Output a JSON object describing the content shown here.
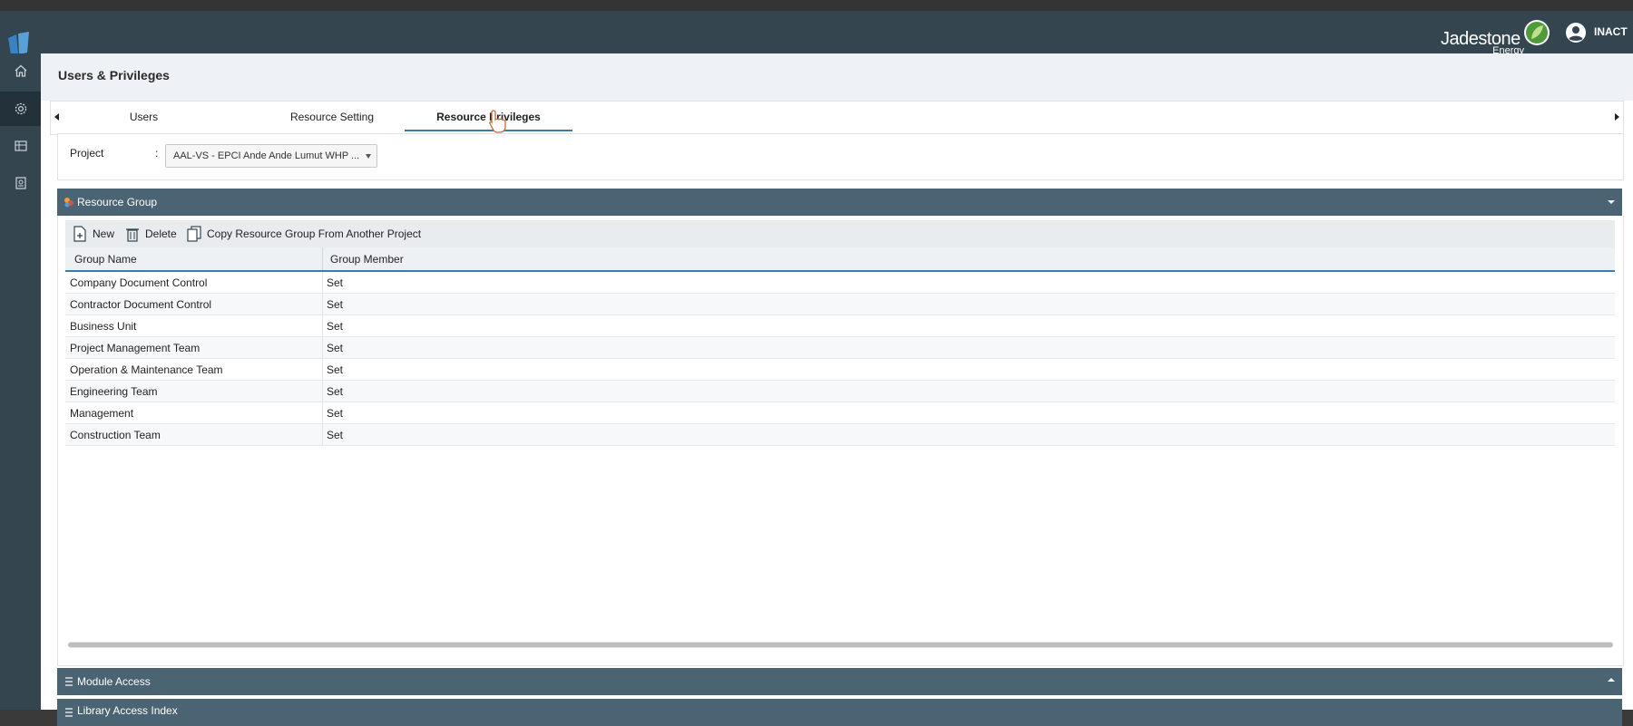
{
  "header": {
    "brand_name": "Jadestone",
    "brand_sub": "Energy",
    "user_name": "INACT"
  },
  "sidebar": {
    "items": [
      {
        "icon": "home-icon"
      },
      {
        "icon": "gear-icon",
        "active": true
      },
      {
        "icon": "dashboard-icon"
      },
      {
        "icon": "report-icon"
      }
    ]
  },
  "page": {
    "title": "Users & Privileges"
  },
  "tabs": [
    {
      "label": "Users"
    },
    {
      "label": "Resource Setting"
    },
    {
      "label": "Resource Privileges",
      "active": true
    }
  ],
  "project": {
    "label": "Project",
    "colon": ":",
    "value": "AAL-VS - EPCI Ande Ande Lumut WHP ..."
  },
  "resource_group": {
    "title": "Resource Group",
    "toolbar": {
      "new_label": "New",
      "delete_label": "Delete",
      "copy_label": "Copy Resource Group From Another Project"
    },
    "columns": {
      "group_name": "Group Name",
      "group_member": "Group Member"
    },
    "rows": [
      {
        "name": "Company Document Control",
        "member": "Set"
      },
      {
        "name": "Contractor Document Control",
        "member": "Set"
      },
      {
        "name": "Business Unit",
        "member": "Set"
      },
      {
        "name": "Project Management Team",
        "member": "Set"
      },
      {
        "name": "Operation & Maintenance Team",
        "member": "Set"
      },
      {
        "name": "Engineering Team",
        "member": "Set"
      },
      {
        "name": "Management",
        "member": "Set"
      },
      {
        "name": "Construction Team",
        "member": "Set"
      }
    ]
  },
  "module_access": {
    "title": "Module Access"
  },
  "library_access": {
    "title": "Library Access Index"
  },
  "colors": {
    "header_bg": "#34454f",
    "section_bar": "#4a6473",
    "accent": "#3d7ea6"
  }
}
